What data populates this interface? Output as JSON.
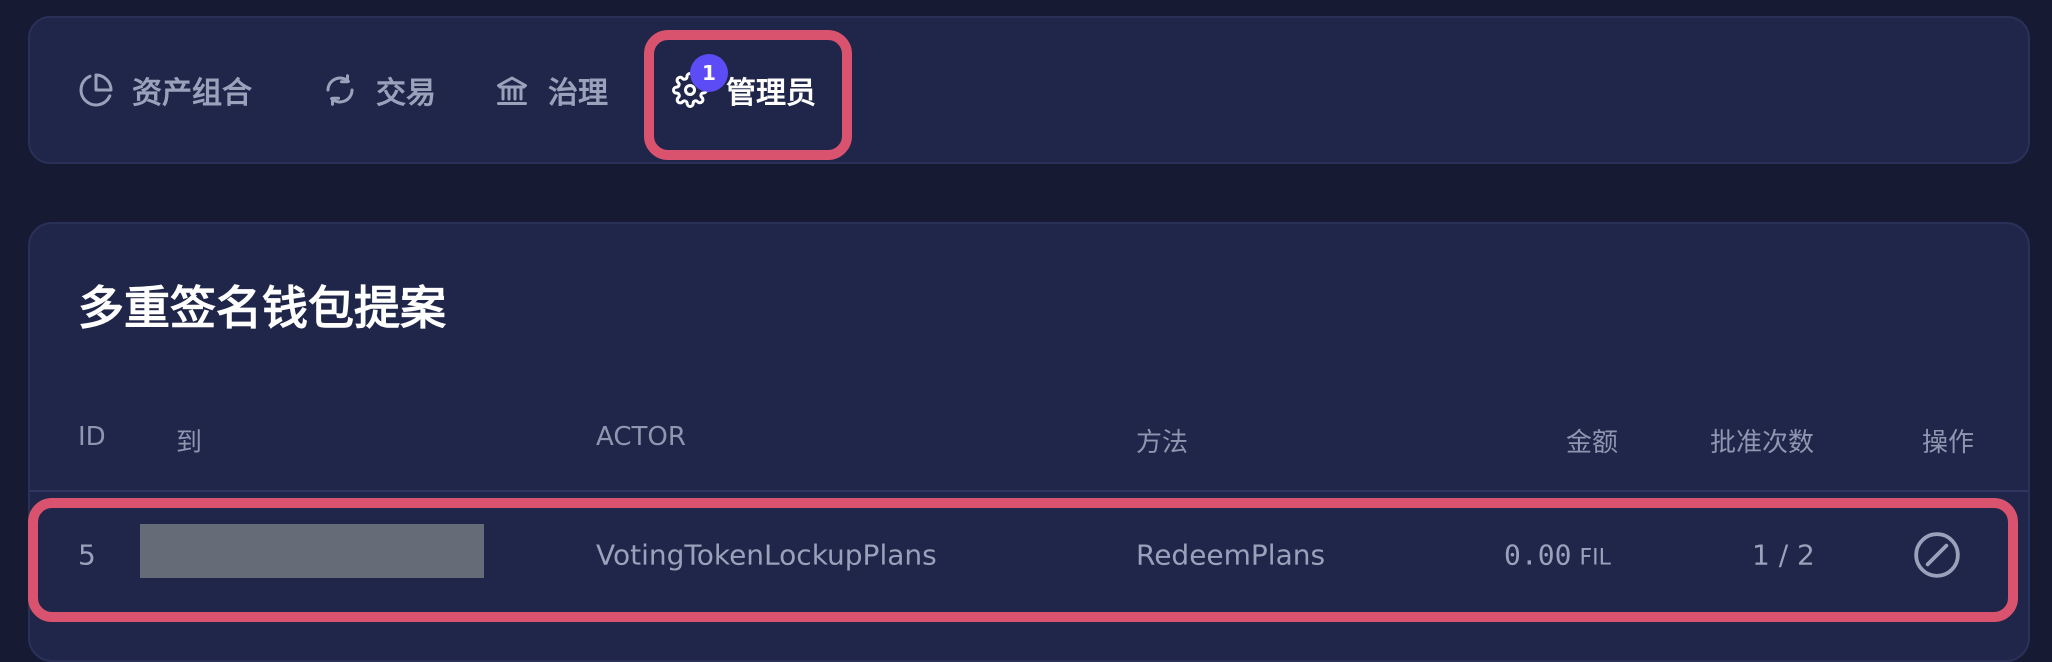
{
  "nav": {
    "items": [
      {
        "label": "资产组合",
        "icon": "pie-chart-icon"
      },
      {
        "label": "交易",
        "icon": "refresh-icon"
      },
      {
        "label": "治理",
        "icon": "bank-icon"
      },
      {
        "label": "管理员",
        "icon": "gear-icon",
        "badge": "1",
        "active": true
      }
    ]
  },
  "proposals": {
    "title": "多重签名钱包提案",
    "columns": {
      "id": "ID",
      "to": "到",
      "actor": "ACTOR",
      "method": "方法",
      "amount": "金额",
      "approvals": "批准次数",
      "action": "操作"
    },
    "rows": [
      {
        "id": "5",
        "actor": "VotingTokenLockupPlans",
        "method": "RedeemPlans",
        "amount": "0.00",
        "unit": "FIL",
        "approvals": "1 / 2",
        "action_icon": "cancel-icon"
      }
    ]
  },
  "colors": {
    "background": "#161b33",
    "card": "#20264a",
    "highlight": "#d9536f",
    "badge": "#5b4cf5",
    "redacted": "#656b77"
  }
}
